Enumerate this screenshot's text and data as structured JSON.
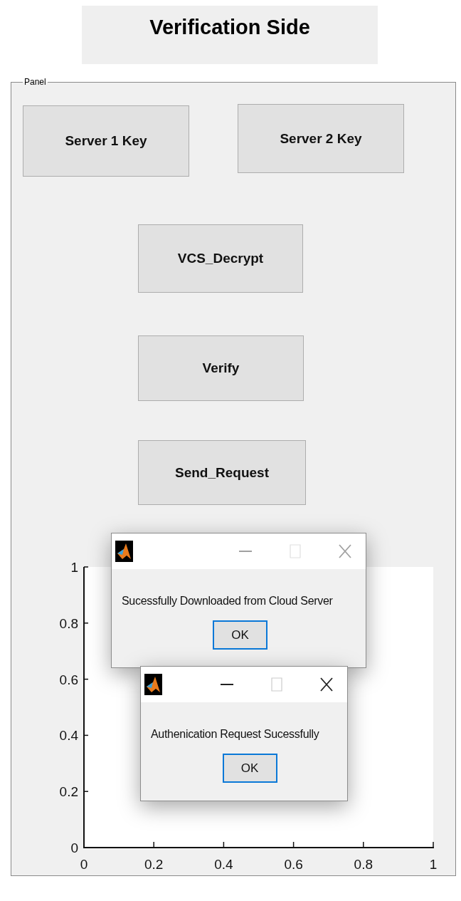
{
  "title": "Verification Side",
  "panel": {
    "title": "Panel",
    "buttons": [
      {
        "label": "Server 1 Key"
      },
      {
        "label": "Server 2 Key"
      },
      {
        "label": "VCS_Decrypt"
      },
      {
        "label": "Verify"
      },
      {
        "label": "Send_Request"
      }
    ],
    "axes": {
      "chart_data": {
        "type": "line",
        "xlim": [
          0,
          1
        ],
        "ylim": [
          0,
          1
        ],
        "xticks": [
          0,
          0.2,
          0.4,
          0.6,
          0.8,
          1
        ],
        "yticks": [
          0,
          0.2,
          0.4,
          0.6,
          0.8,
          1
        ]
      }
    }
  },
  "dialogs": [
    {
      "message": "Sucessfully Downloaded from Cloud Server",
      "button": "OK",
      "active": false
    },
    {
      "message": "Authenication Request Sucessfully",
      "button": "OK",
      "active": true
    }
  ]
}
